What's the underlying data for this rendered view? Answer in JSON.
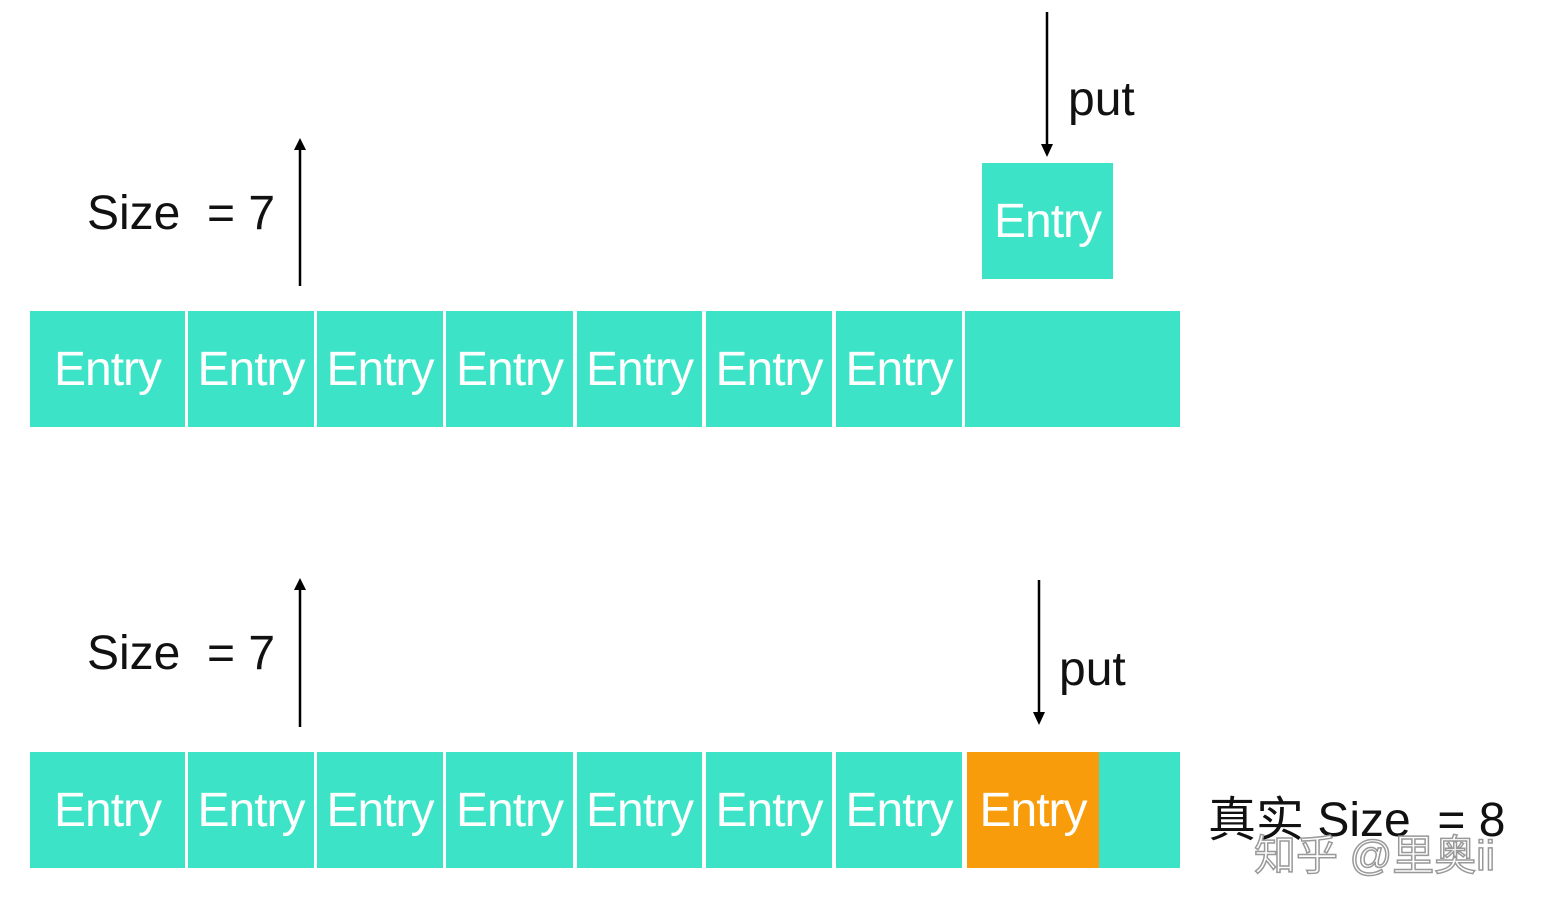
{
  "top": {
    "size_label": "Size  = 7",
    "put_label": "put",
    "new_entry": "Entry",
    "cells": [
      "Entry",
      "Entry",
      "Entry",
      "Entry",
      "Entry",
      "Entry",
      "Entry",
      ""
    ]
  },
  "bottom": {
    "size_label": "Size  = 7",
    "put_label": "put",
    "real_size_label": "真实 Size  = 8",
    "cells": [
      "Entry",
      "Entry",
      "Entry",
      "Entry",
      "Entry",
      "Entry",
      "Entry",
      "Entry",
      ""
    ]
  },
  "watermark": "知乎 @里奥ii",
  "colors": {
    "entry": "#3de3c7",
    "inserted_entry": "#f89c0b"
  }
}
